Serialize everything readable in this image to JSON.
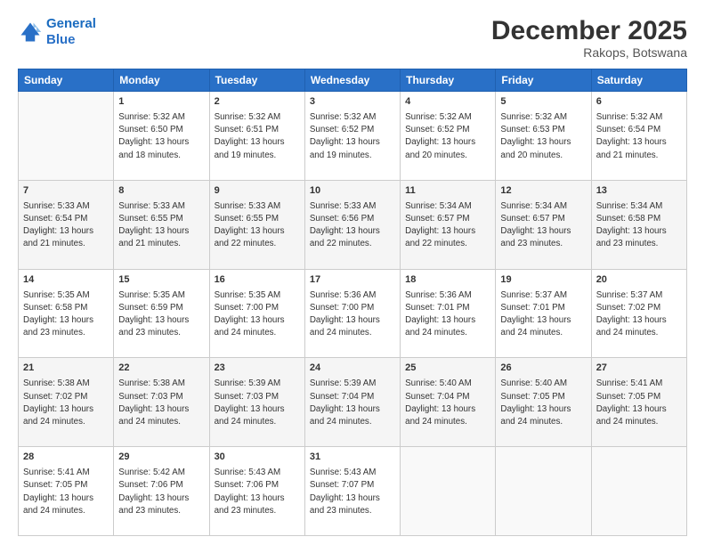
{
  "logo": {
    "line1": "General",
    "line2": "Blue"
  },
  "title": "December 2025",
  "subtitle": "Rakops, Botswana",
  "days_of_week": [
    "Sunday",
    "Monday",
    "Tuesday",
    "Wednesday",
    "Thursday",
    "Friday",
    "Saturday"
  ],
  "weeks": [
    [
      {
        "day": null,
        "info": null
      },
      {
        "day": "1",
        "info": "Sunrise: 5:32 AM\nSunset: 6:50 PM\nDaylight: 13 hours\nand 18 minutes."
      },
      {
        "day": "2",
        "info": "Sunrise: 5:32 AM\nSunset: 6:51 PM\nDaylight: 13 hours\nand 19 minutes."
      },
      {
        "day": "3",
        "info": "Sunrise: 5:32 AM\nSunset: 6:52 PM\nDaylight: 13 hours\nand 19 minutes."
      },
      {
        "day": "4",
        "info": "Sunrise: 5:32 AM\nSunset: 6:52 PM\nDaylight: 13 hours\nand 20 minutes."
      },
      {
        "day": "5",
        "info": "Sunrise: 5:32 AM\nSunset: 6:53 PM\nDaylight: 13 hours\nand 20 minutes."
      },
      {
        "day": "6",
        "info": "Sunrise: 5:32 AM\nSunset: 6:54 PM\nDaylight: 13 hours\nand 21 minutes."
      }
    ],
    [
      {
        "day": "7",
        "info": "Sunrise: 5:33 AM\nSunset: 6:54 PM\nDaylight: 13 hours\nand 21 minutes."
      },
      {
        "day": "8",
        "info": "Sunrise: 5:33 AM\nSunset: 6:55 PM\nDaylight: 13 hours\nand 21 minutes."
      },
      {
        "day": "9",
        "info": "Sunrise: 5:33 AM\nSunset: 6:55 PM\nDaylight: 13 hours\nand 22 minutes."
      },
      {
        "day": "10",
        "info": "Sunrise: 5:33 AM\nSunset: 6:56 PM\nDaylight: 13 hours\nand 22 minutes."
      },
      {
        "day": "11",
        "info": "Sunrise: 5:34 AM\nSunset: 6:57 PM\nDaylight: 13 hours\nand 22 minutes."
      },
      {
        "day": "12",
        "info": "Sunrise: 5:34 AM\nSunset: 6:57 PM\nDaylight: 13 hours\nand 23 minutes."
      },
      {
        "day": "13",
        "info": "Sunrise: 5:34 AM\nSunset: 6:58 PM\nDaylight: 13 hours\nand 23 minutes."
      }
    ],
    [
      {
        "day": "14",
        "info": "Sunrise: 5:35 AM\nSunset: 6:58 PM\nDaylight: 13 hours\nand 23 minutes."
      },
      {
        "day": "15",
        "info": "Sunrise: 5:35 AM\nSunset: 6:59 PM\nDaylight: 13 hours\nand 23 minutes."
      },
      {
        "day": "16",
        "info": "Sunrise: 5:35 AM\nSunset: 7:00 PM\nDaylight: 13 hours\nand 24 minutes."
      },
      {
        "day": "17",
        "info": "Sunrise: 5:36 AM\nSunset: 7:00 PM\nDaylight: 13 hours\nand 24 minutes."
      },
      {
        "day": "18",
        "info": "Sunrise: 5:36 AM\nSunset: 7:01 PM\nDaylight: 13 hours\nand 24 minutes."
      },
      {
        "day": "19",
        "info": "Sunrise: 5:37 AM\nSunset: 7:01 PM\nDaylight: 13 hours\nand 24 minutes."
      },
      {
        "day": "20",
        "info": "Sunrise: 5:37 AM\nSunset: 7:02 PM\nDaylight: 13 hours\nand 24 minutes."
      }
    ],
    [
      {
        "day": "21",
        "info": "Sunrise: 5:38 AM\nSunset: 7:02 PM\nDaylight: 13 hours\nand 24 minutes."
      },
      {
        "day": "22",
        "info": "Sunrise: 5:38 AM\nSunset: 7:03 PM\nDaylight: 13 hours\nand 24 minutes."
      },
      {
        "day": "23",
        "info": "Sunrise: 5:39 AM\nSunset: 7:03 PM\nDaylight: 13 hours\nand 24 minutes."
      },
      {
        "day": "24",
        "info": "Sunrise: 5:39 AM\nSunset: 7:04 PM\nDaylight: 13 hours\nand 24 minutes."
      },
      {
        "day": "25",
        "info": "Sunrise: 5:40 AM\nSunset: 7:04 PM\nDaylight: 13 hours\nand 24 minutes."
      },
      {
        "day": "26",
        "info": "Sunrise: 5:40 AM\nSunset: 7:05 PM\nDaylight: 13 hours\nand 24 minutes."
      },
      {
        "day": "27",
        "info": "Sunrise: 5:41 AM\nSunset: 7:05 PM\nDaylight: 13 hours\nand 24 minutes."
      }
    ],
    [
      {
        "day": "28",
        "info": "Sunrise: 5:41 AM\nSunset: 7:05 PM\nDaylight: 13 hours\nand 24 minutes."
      },
      {
        "day": "29",
        "info": "Sunrise: 5:42 AM\nSunset: 7:06 PM\nDaylight: 13 hours\nand 23 minutes."
      },
      {
        "day": "30",
        "info": "Sunrise: 5:43 AM\nSunset: 7:06 PM\nDaylight: 13 hours\nand 23 minutes."
      },
      {
        "day": "31",
        "info": "Sunrise: 5:43 AM\nSunset: 7:07 PM\nDaylight: 13 hours\nand 23 minutes."
      },
      {
        "day": null,
        "info": null
      },
      {
        "day": null,
        "info": null
      },
      {
        "day": null,
        "info": null
      }
    ]
  ]
}
